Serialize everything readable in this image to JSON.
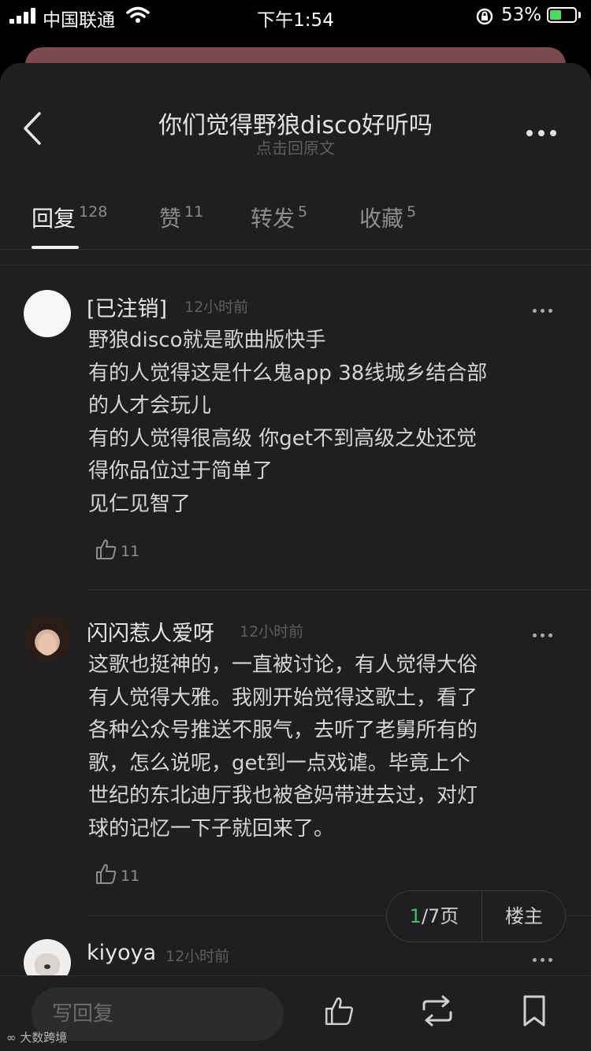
{
  "status_bar": {
    "carrier": "中国联通",
    "time": "下午1:54",
    "battery_percent": "53%",
    "battery_level": 0.53,
    "icons": [
      "signal-icon",
      "wifi-icon",
      "rotation-lock-icon",
      "battery-charging-icon"
    ]
  },
  "header": {
    "title": "你们觉得野狼disco好听吗",
    "subtitle": "点击回原文",
    "back_icon": "chevron-left-icon",
    "more_icon": "more-icon"
  },
  "tabs": [
    {
      "label": "回复",
      "count": "128",
      "active": true
    },
    {
      "label": "赞",
      "count": "11",
      "active": false
    },
    {
      "label": "转发",
      "count": "5",
      "active": false
    },
    {
      "label": "收藏",
      "count": "5",
      "active": false
    }
  ],
  "comments": [
    {
      "username": "[已注销]",
      "time": "12小时前",
      "lines": [
        "野狼disco就是歌曲版快手",
        "有的人觉得这是什么鬼app 38线城乡结合部",
        "的人才会玩儿",
        "有的人觉得很高级 你get不到高级之处还觉",
        "得你品位过于简单了",
        "见仁见智了"
      ],
      "likes": "11"
    },
    {
      "username": "闪闪惹人爱呀",
      "time": "12小时前",
      "lines": [
        "这歌也挺神的，一直被讨论，有人觉得大俗",
        "有人觉得大雅。我刚开始觉得这歌土，看了",
        "各种公众号推送不服气，去听了老舅所有的",
        "歌，怎么说呢，get到一点戏谑。毕竟上个",
        "世纪的东北迪厅我也被爸妈带进去过，对灯",
        "球的记忆一下子就回来了。"
      ],
      "likes": "11"
    },
    {
      "username": "kiyoya",
      "time": "12小时前"
    }
  ],
  "pager": {
    "current": "1",
    "total_suffix": "/7页",
    "owner_label": "楼主"
  },
  "bottom_bar": {
    "reply_placeholder": "写回复",
    "icons": [
      "like-icon",
      "repost-icon",
      "bookmark-icon"
    ]
  },
  "watermark": "大数跨境",
  "colors": {
    "background": "#1f1f21",
    "accent_green": "#3fbf6a",
    "battery_green": "#4cd964"
  }
}
